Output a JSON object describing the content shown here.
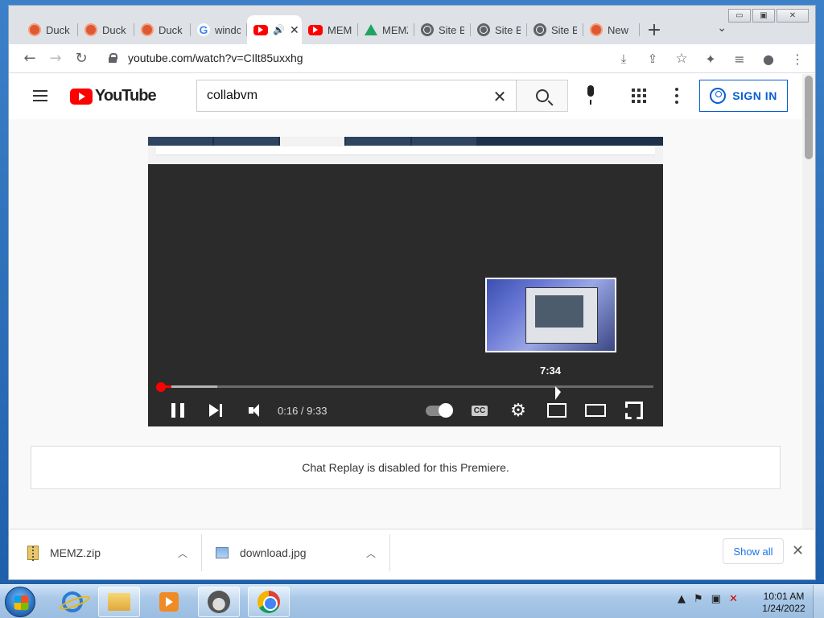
{
  "window": {
    "minimize": "▭",
    "restore": "▣",
    "close": "✕"
  },
  "tabs": [
    {
      "label": "DuckDuckGo",
      "favicon": "duckduckgo-icon"
    },
    {
      "label": "DuckDuckGo",
      "favicon": "duckduckgo-icon"
    },
    {
      "label": "DuckDuckGo",
      "favicon": "duckduckgo-icon"
    },
    {
      "label": "windows",
      "favicon": "google-icon"
    },
    {
      "label": "",
      "favicon": "youtube-icon",
      "active": true,
      "audio": "speaker-icon"
    },
    {
      "label": "MEMZ",
      "favicon": "youtube-icon"
    },
    {
      "label": "MEMZ",
      "favicon": "google-drive-icon"
    },
    {
      "label": "Site B",
      "favicon": "globe-icon"
    },
    {
      "label": "Site B",
      "favicon": "globe-icon"
    },
    {
      "label": "Site B",
      "favicon": "globe-icon"
    },
    {
      "label": "New",
      "favicon": "duckduckgo-icon"
    }
  ],
  "tab_labels_visible": [
    "Duck",
    "Duck",
    "Duck",
    "windc",
    "",
    "MEMZ",
    "MEMZ",
    "Site B",
    "Site B",
    "Site B",
    "New"
  ],
  "toolbar": {
    "url": "youtube.com/watch?v=CIlt85uxxhg"
  },
  "youtube": {
    "logo_text": "YouTube",
    "search_value": "collabvm",
    "sign_in": "SIGN IN"
  },
  "player": {
    "preview_time": "7:34",
    "timecode": "0:16 / 9:33",
    "progress_fraction": 0.028,
    "buffer_fraction": 0.12,
    "volume": "on",
    "autoplay": "on"
  },
  "chat": {
    "message": "Chat Replay is disabled for this Premiere."
  },
  "downloads": {
    "items": [
      {
        "name": "MEMZ.zip",
        "icon": "zip-file-icon"
      },
      {
        "name": "download.jpg",
        "icon": "image-file-icon"
      }
    ],
    "show_all": "Show all"
  },
  "taskbar": {
    "time": "10:01 AM",
    "date": "1/24/2022"
  }
}
